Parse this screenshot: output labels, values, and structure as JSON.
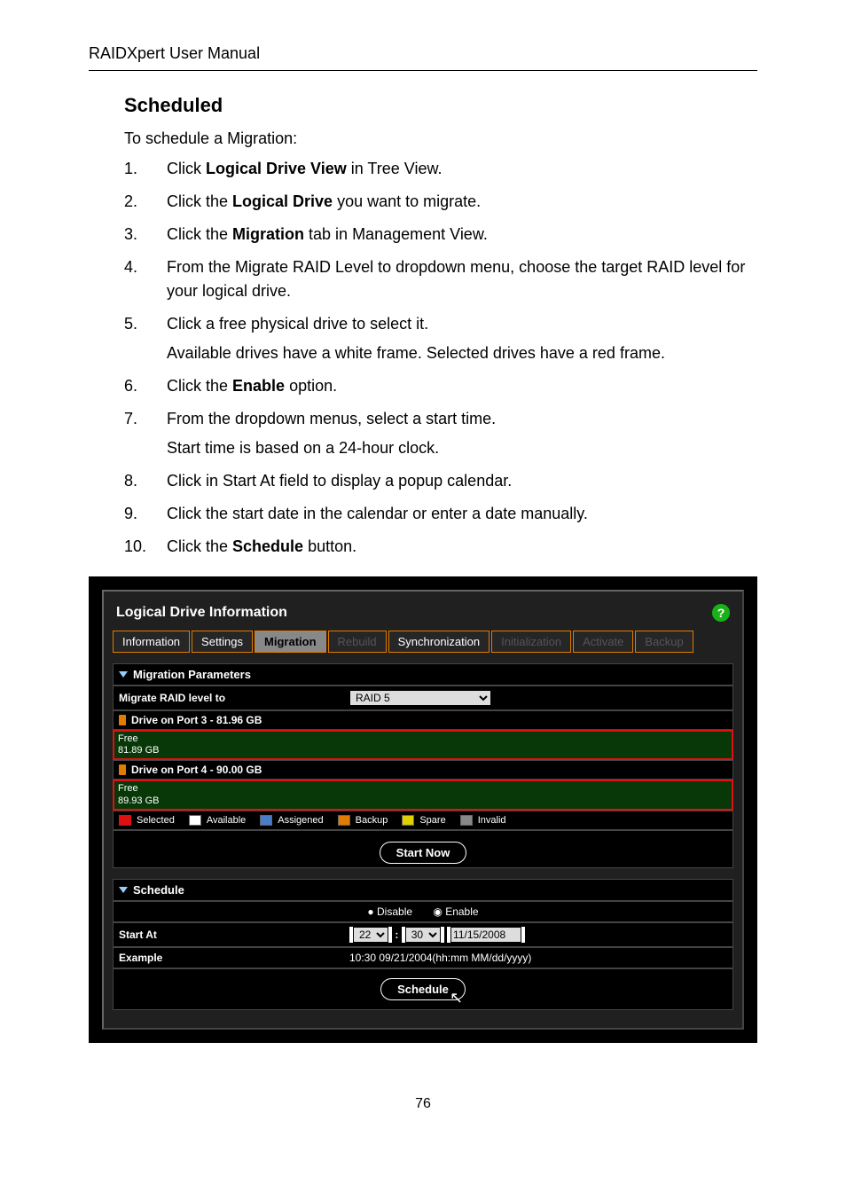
{
  "header": "RAIDXpert User Manual",
  "section_title": "Scheduled",
  "intro": "To schedule a Migration:",
  "steps": [
    {
      "n": "1.",
      "pre": "Click ",
      "b": "Logical Drive View",
      "post": " in Tree View."
    },
    {
      "n": "2.",
      "pre": "Click the ",
      "b": "Logical Drive",
      "post": " you want to migrate."
    },
    {
      "n": "3.",
      "pre": "Click the ",
      "b": "Migration",
      "post": " tab in Management View."
    },
    {
      "n": "4.",
      "plain": "From the Migrate RAID Level to dropdown menu, choose the target RAID level for your logical drive."
    },
    {
      "n": "5.",
      "plain": "Click a free physical drive to select it.",
      "extra": "Available drives have a white frame. Selected drives have a red frame."
    },
    {
      "n": "6.",
      "pre": "Click the ",
      "b": "Enable",
      "post": " option."
    },
    {
      "n": "7.",
      "plain": "From the dropdown menus, select a start time.",
      "extra": "Start time is based on a 24-hour clock."
    },
    {
      "n": "8.",
      "plain": "Click in Start At field to display a popup calendar."
    },
    {
      "n": "9.",
      "plain": "Click the start date in the calendar or enter a date manually."
    },
    {
      "n": "10.",
      "pre": "Click the ",
      "b": "Schedule",
      "post": " button."
    }
  ],
  "ui": {
    "title": "Logical Drive Information",
    "tabs": [
      "Information",
      "Settings",
      "Migration",
      "Rebuild",
      "Synchronization",
      "Initialization",
      "Activate",
      "Backup"
    ],
    "tabs_disabled": [
      "Rebuild",
      "Initialization",
      "Activate",
      "Backup"
    ],
    "tab_active": "Migration",
    "group1": "Migration Parameters",
    "migrate_label": "Migrate RAID level to",
    "migrate_value": "RAID 5",
    "drive3_hdr": "Drive on Port 3 - 81.96 GB",
    "drive3_line1": "Free",
    "drive3_line2": "81.89 GB",
    "drive4_hdr": "Drive on Port 4 - 90.00 GB",
    "drive4_line1": "Free",
    "drive4_line2": "89.93 GB",
    "legend": [
      "Selected",
      "Available",
      "Assigened",
      "Backup",
      "Spare",
      "Invalid"
    ],
    "start_now": "Start Now",
    "group2": "Schedule",
    "disable": "Disable",
    "enable": "Enable",
    "start_at_label": "Start At",
    "hour": "22",
    "minute": "30",
    "date": "11/15/2008",
    "example_label": "Example",
    "example_value": "10:30 09/21/2004(hh:mm MM/dd/yyyy)",
    "schedule_btn": "Schedule"
  },
  "page_num": "76"
}
